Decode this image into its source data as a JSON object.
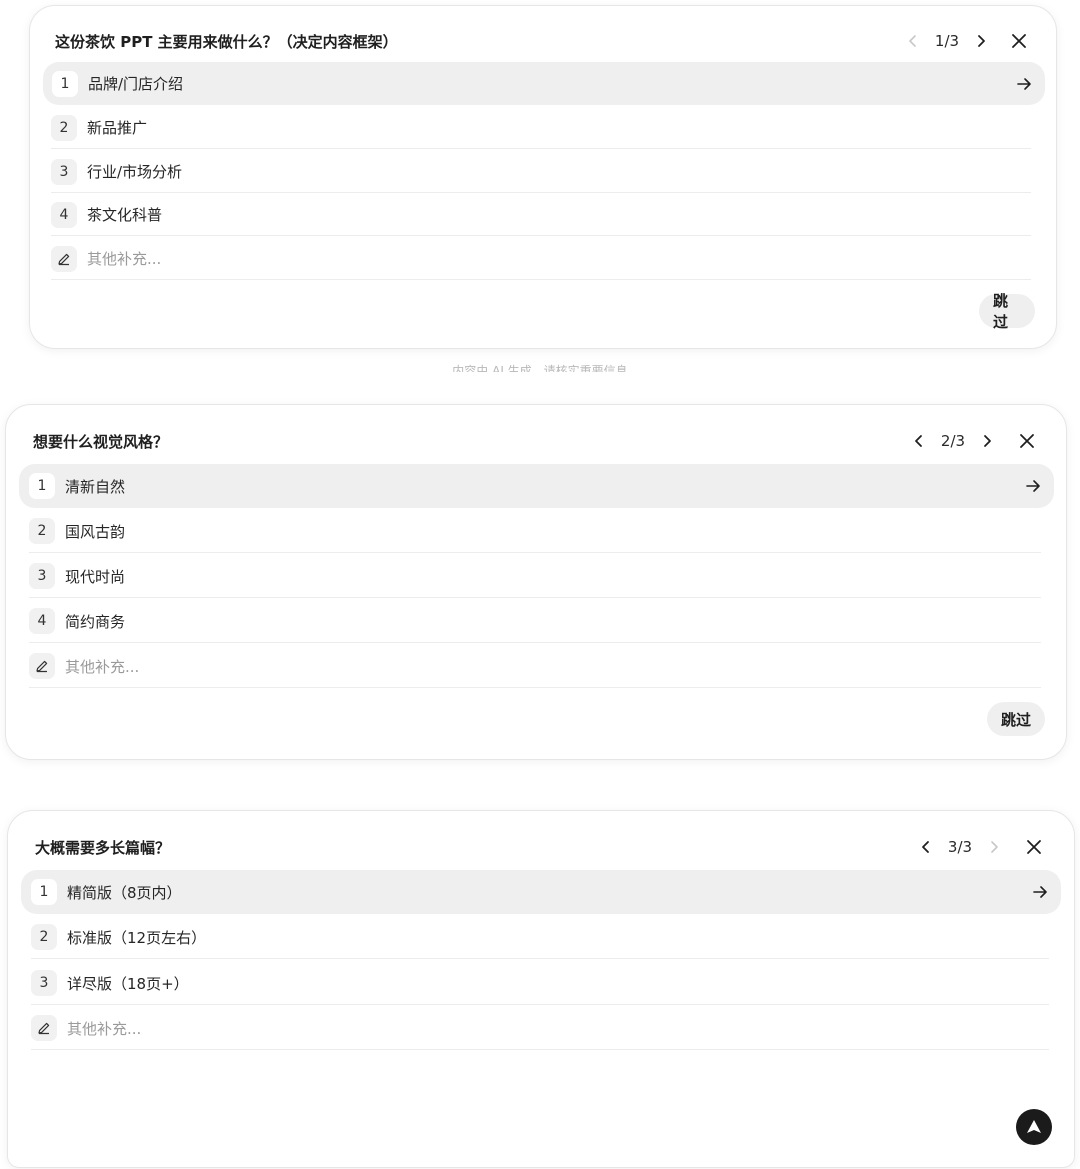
{
  "disclaimer": "内容由 AI 生成，请核实重要信息",
  "cards": [
    {
      "question": "这份茶饮 PPT 主要用来做什么？（决定内容框架）",
      "pager": "1/3",
      "prev_disabled": true,
      "next_disabled": false,
      "options": [
        {
          "num": "1",
          "label": "品牌/门店介绍",
          "active": true
        },
        {
          "num": "2",
          "label": "新品推广"
        },
        {
          "num": "3",
          "label": "行业/市场分析"
        },
        {
          "num": "4",
          "label": "茶文化科普"
        }
      ],
      "other_placeholder": "其他补充...",
      "skip_label": "跳过"
    },
    {
      "question": "想要什么视觉风格？",
      "pager": "2/3",
      "prev_disabled": false,
      "next_disabled": false,
      "options": [
        {
          "num": "1",
          "label": "清新自然",
          "active": true
        },
        {
          "num": "2",
          "label": "国风古韵"
        },
        {
          "num": "3",
          "label": "现代时尚"
        },
        {
          "num": "4",
          "label": "简约商务"
        }
      ],
      "other_placeholder": "其他补充...",
      "skip_label": "跳过"
    },
    {
      "question": "大概需要多长篇幅？",
      "pager": "3/3",
      "prev_disabled": false,
      "next_disabled": true,
      "options": [
        {
          "num": "1",
          "label": "精简版（8页内）",
          "active": true
        },
        {
          "num": "2",
          "label": "标准版（12页左右）"
        },
        {
          "num": "3",
          "label": "详尽版（18页+）"
        }
      ],
      "other_placeholder": "其他补充..."
    }
  ],
  "icons": {
    "arrow": "arrow-right-icon",
    "close": "close-icon",
    "prev": "chevron-left-icon",
    "next": "chevron-right-icon",
    "edit": "pencil-icon",
    "fab": "caret-up-icon"
  },
  "colors": {
    "active_row": "#efefef",
    "disabled": "#c8c8c8",
    "fab": "#1b1b1b"
  }
}
